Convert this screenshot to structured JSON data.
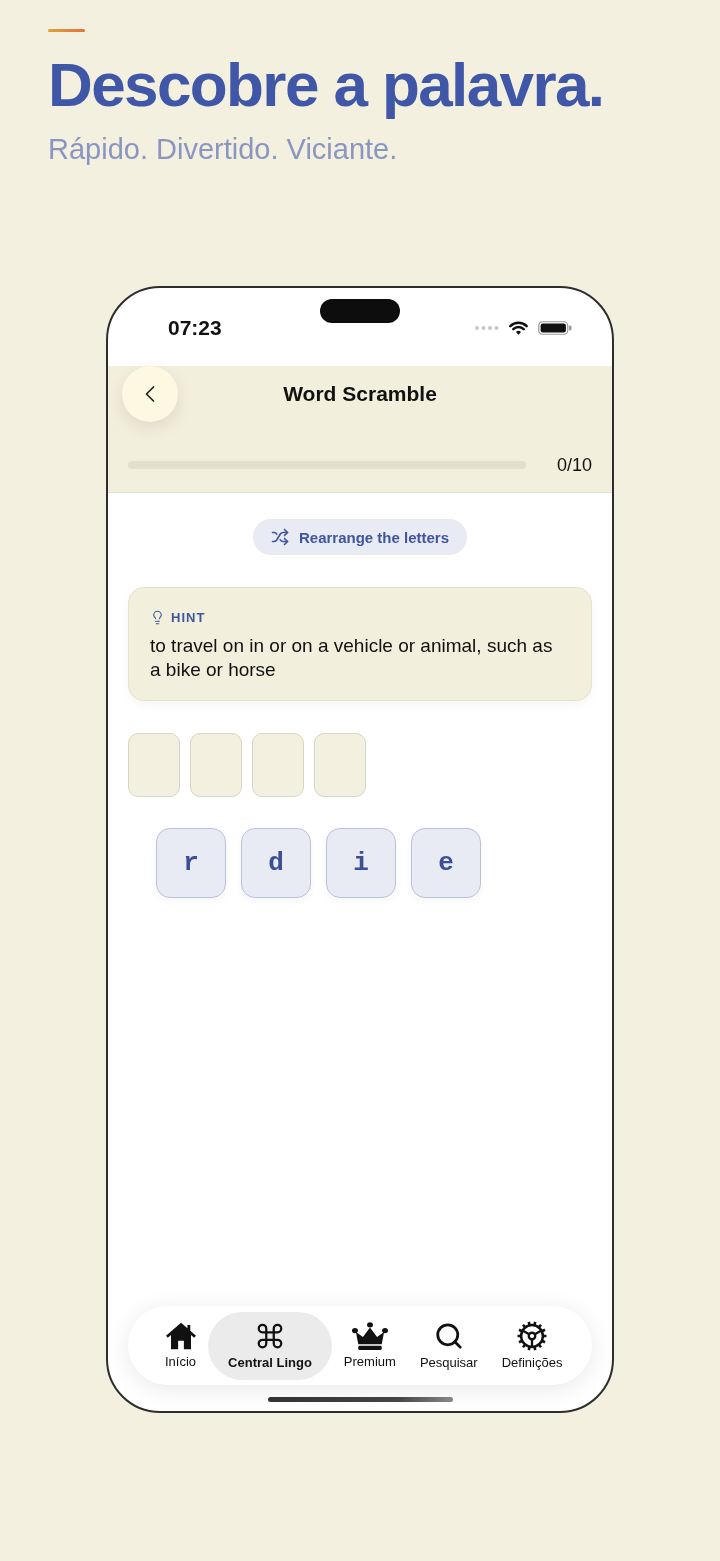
{
  "promo": {
    "title": "Descobre a palavra.",
    "subtitle": "Rápido. Divertido. Viciante."
  },
  "status_bar": {
    "time": "07:23"
  },
  "screen": {
    "title": "Word Scramble",
    "progress": {
      "level": 0,
      "reading": "0/10"
    }
  },
  "shuffle_button": {
    "label": "Rearrange the letters"
  },
  "hint": {
    "label": "HINT",
    "text": "to travel on in or on a vehicle or animal, such as a bike or horse"
  },
  "answer_slots": [
    {
      "filled": false
    },
    {
      "filled": false
    },
    {
      "filled": false
    },
    {
      "filled": false
    }
  ],
  "letter_tiles": [
    {
      "letter": "r"
    },
    {
      "letter": "d"
    },
    {
      "letter": "i"
    },
    {
      "letter": "e"
    }
  ],
  "tab_bar": [
    {
      "label": "Início",
      "selected": false
    },
    {
      "label": "Central Lingo",
      "selected": true
    },
    {
      "label": "Premium",
      "selected": false
    },
    {
      "label": "Pesquisar",
      "selected": false
    },
    {
      "label": "Definições",
      "selected": false
    }
  ]
}
